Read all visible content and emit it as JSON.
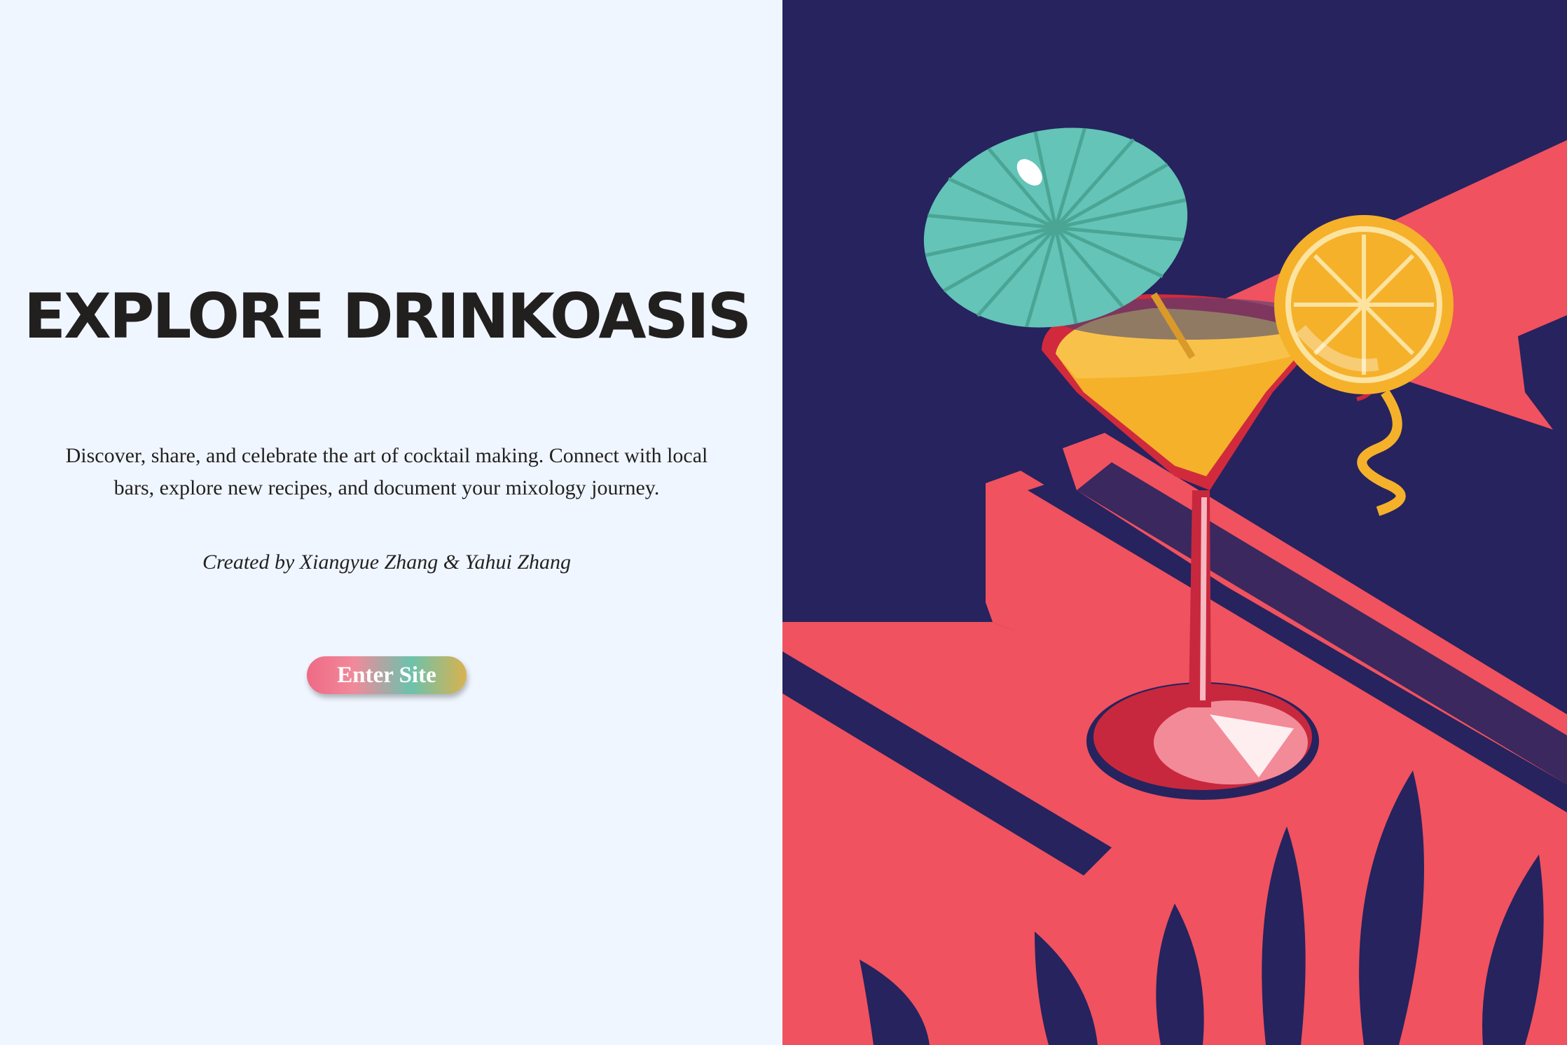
{
  "hero": {
    "title": "EXPLORE DRINKOASIS",
    "description": "Discover, share, and celebrate the art of cocktail making. Connect with local bars, explore new recipes, and document your mixology journey.",
    "credit": "Created by Xiangyue Zhang & Yahui Zhang",
    "enter_button": "Enter Site"
  },
  "illustration": {
    "subject": "cocktail-glass-with-umbrella-and-orange-slice",
    "colors": {
      "background": "#26235e",
      "table": "#f0525f",
      "umbrella": "#63c4b7",
      "drink": "#f5b12a",
      "glass_rim": "#d12a3d",
      "page_bg": "#f0f6ff"
    }
  }
}
